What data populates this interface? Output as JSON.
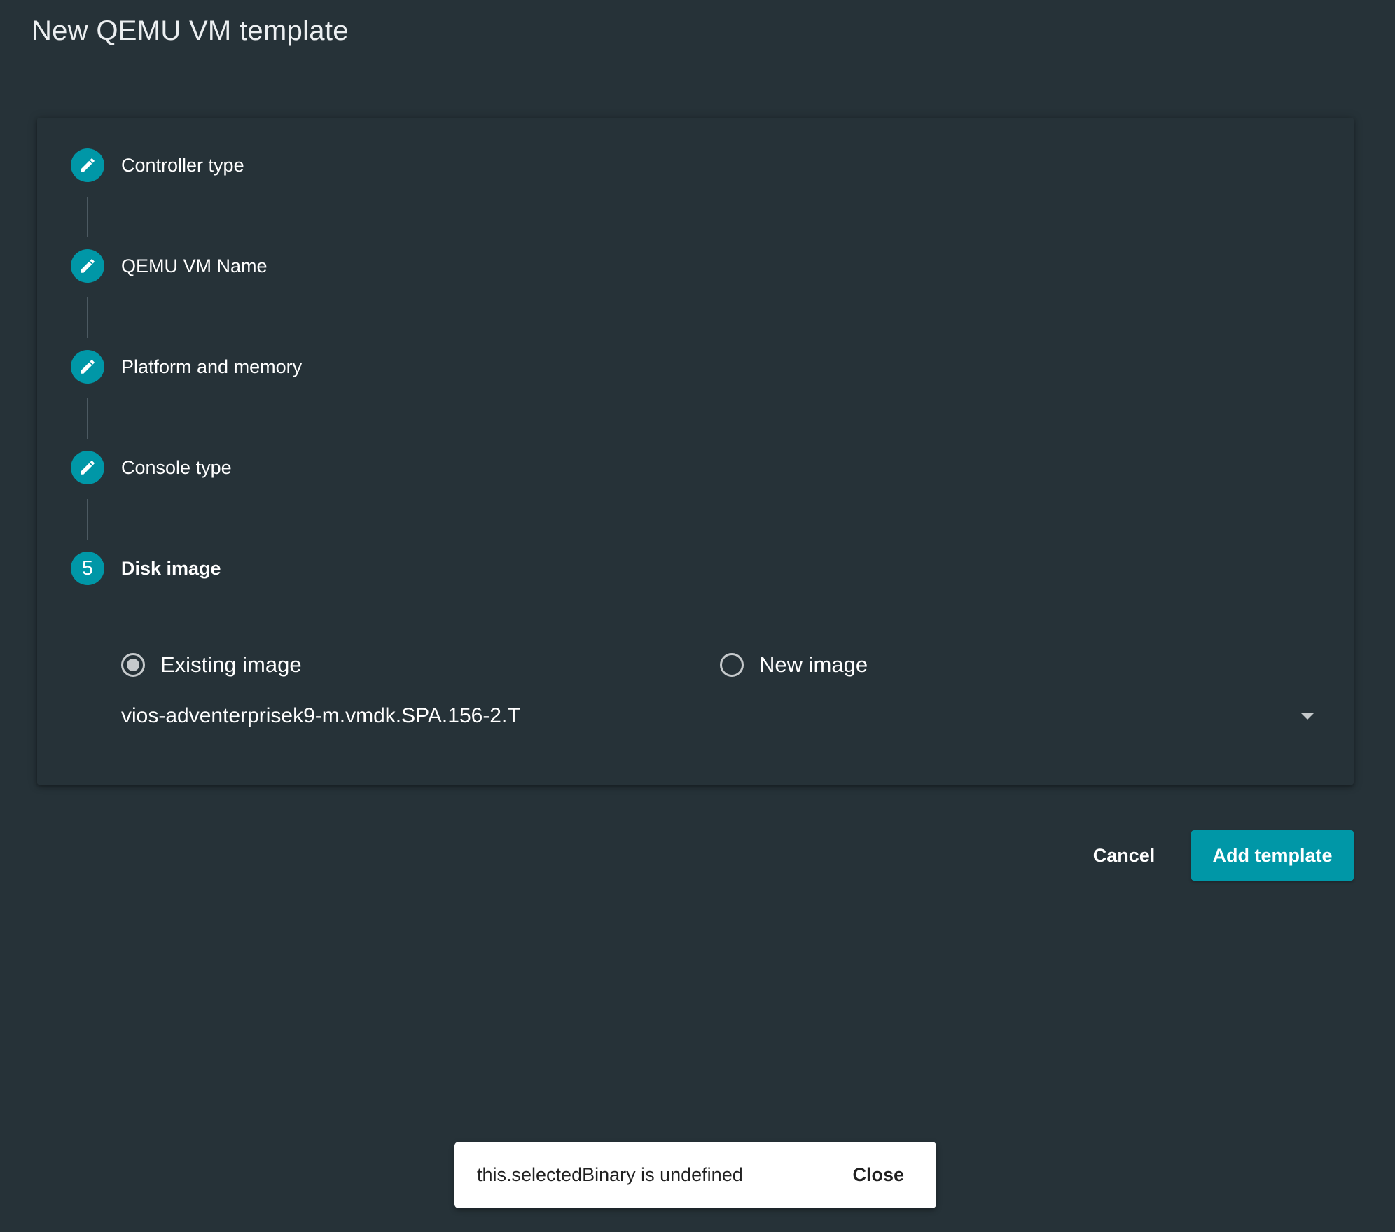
{
  "page": {
    "title": "New QEMU VM template"
  },
  "stepper": {
    "steps": [
      {
        "label": "Controller type",
        "icon": "pencil-icon",
        "state": "completed"
      },
      {
        "label": "QEMU VM Name",
        "icon": "pencil-icon",
        "state": "completed"
      },
      {
        "label": "Platform and memory",
        "icon": "pencil-icon",
        "state": "completed"
      },
      {
        "label": "Console type",
        "icon": "pencil-icon",
        "state": "completed"
      },
      {
        "label": "Disk image",
        "number": "5",
        "state": "active"
      }
    ]
  },
  "disk_image": {
    "options": [
      {
        "label": "Existing image",
        "selected": true
      },
      {
        "label": "New image",
        "selected": false
      }
    ],
    "selected_image": "vios-adventerprisek9-m.vmdk.SPA.156-2.T"
  },
  "actions": {
    "cancel_label": "Cancel",
    "add_label": "Add template"
  },
  "snackbar": {
    "message": "this.selectedBinary is undefined",
    "close_label": "Close"
  },
  "colors": {
    "background": "#263238",
    "accent": "#0097a7",
    "snackbar_bg": "#ffffff"
  }
}
